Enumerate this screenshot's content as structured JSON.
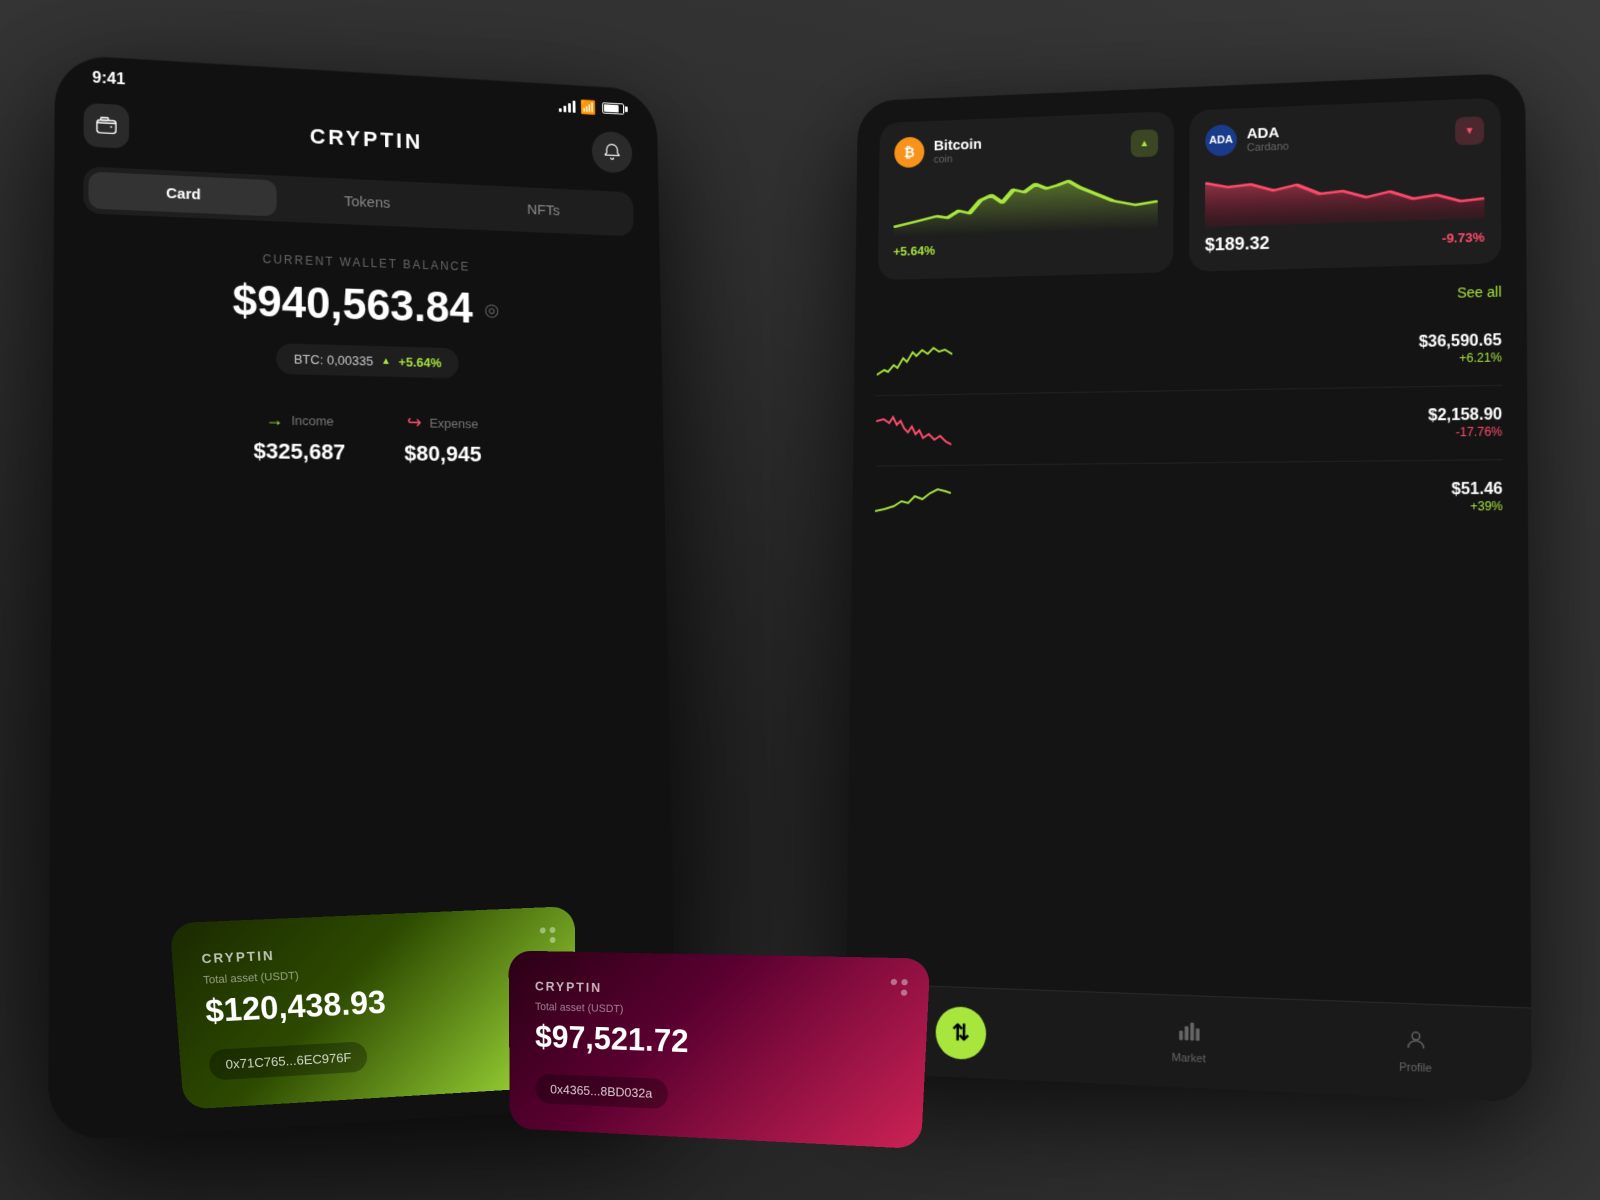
{
  "app": {
    "name": "CRYPTIN",
    "logo": "CRYPTIN",
    "time": "9:41"
  },
  "tabs": {
    "items": [
      {
        "label": "Card",
        "active": true
      },
      {
        "label": "Tokens",
        "active": false
      },
      {
        "label": "NFTs",
        "active": false
      }
    ]
  },
  "balance": {
    "label": "CURRENT WALLET BALANCE",
    "amount": "$940,563.84",
    "btc_value": "BTC: 0,00335",
    "btc_change": "+5.64%"
  },
  "finance": {
    "income_label": "Income",
    "income_value": "$325,687",
    "expense_label": "Expense",
    "expense_value": "$80,945"
  },
  "cards": [
    {
      "brand": "CRYPTIN",
      "label": "Total asset (USDT)",
      "value": "$120,438.93",
      "address": "0x71C765...6EC976F",
      "theme": "green"
    },
    {
      "brand": "CRYPTIN",
      "label": "Total asset (USDT)",
      "value": "$97,521.72",
      "address": "0x4365...8BD032a",
      "theme": "pink"
    }
  ],
  "mini_coins": [
    {
      "symbol": "C",
      "name": "Bitcoin",
      "full_name": "coin",
      "price": "",
      "change": "+5.64%",
      "trend": "up"
    },
    {
      "symbol": "ADA",
      "name": "ADA",
      "full_name": "Cardano",
      "price": "$189.32",
      "change": "-9.73%",
      "trend": "down"
    }
  ],
  "assets": [
    {
      "price": "$36,590.65",
      "change": "+6.21%",
      "trend": "up"
    },
    {
      "price": "$2,158.90",
      "change": "-17.76%",
      "trend": "down"
    },
    {
      "price": "$51.46",
      "change": "+39%",
      "trend": "up"
    }
  ],
  "nav": {
    "items": [
      {
        "label": "Exchange",
        "icon": "⇅",
        "active": false,
        "is_center": true
      },
      {
        "label": "Market",
        "icon": "📊",
        "active": false
      },
      {
        "label": "Profile",
        "icon": "👤",
        "active": false
      }
    ],
    "see_all": "See all"
  },
  "colors": {
    "green_accent": "#a8e63d",
    "red_accent": "#ff4d6d",
    "background": "#111111",
    "card_dark": "#1e1e1e"
  }
}
